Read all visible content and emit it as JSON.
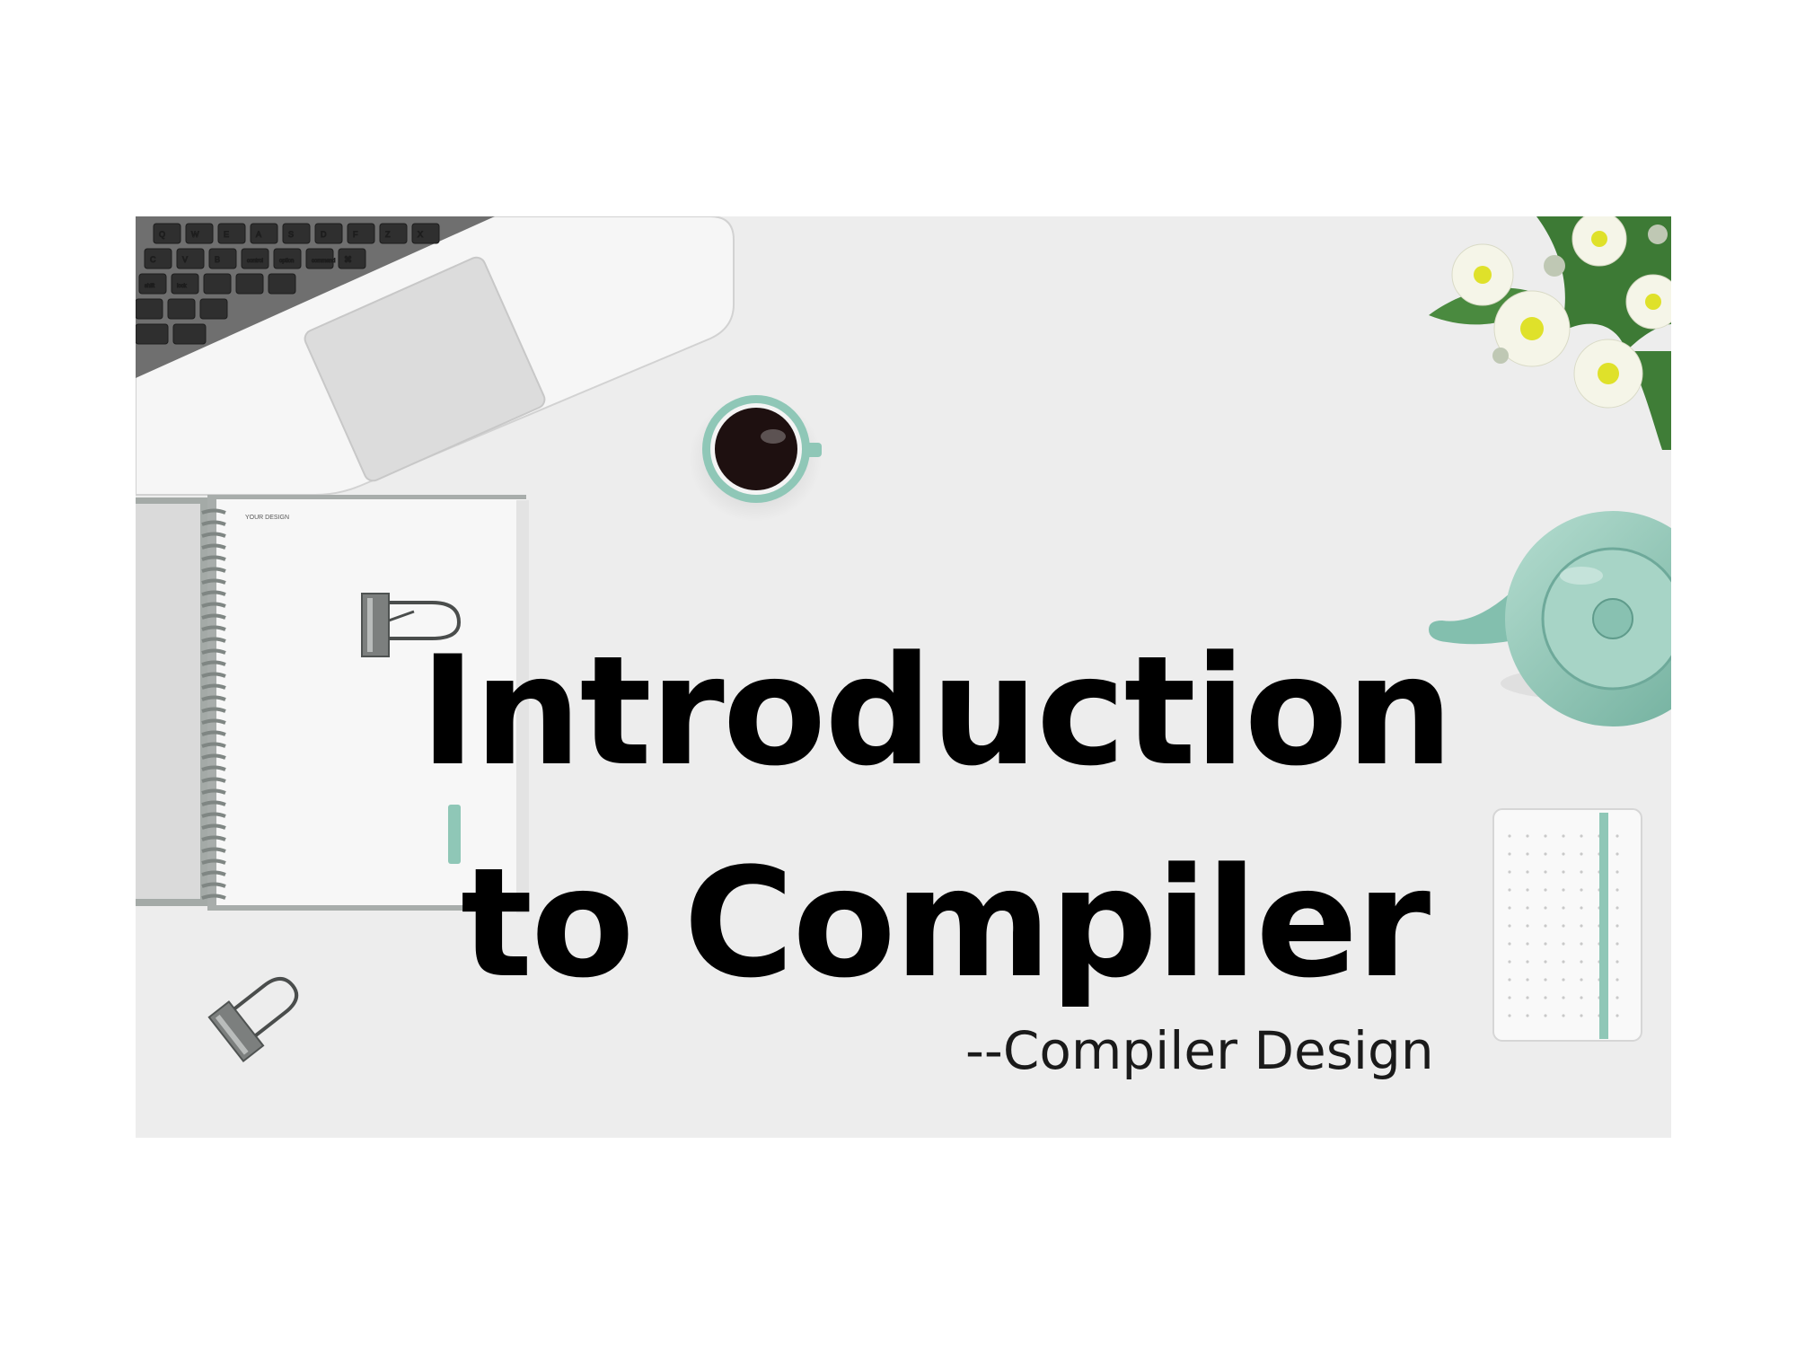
{
  "slide": {
    "title_line_1": "Introduction",
    "title_line_2": "to Compiler",
    "subtitle": "--Compiler Design",
    "notebook_label": "YOUR DESIGN"
  },
  "keyboard_keys": [
    "Q",
    "W",
    "E",
    "A",
    "S",
    "D",
    "F",
    "Z",
    "X",
    "C",
    "V",
    "B",
    "control",
    "option",
    "command",
    "⌘",
    "shift",
    "lock"
  ],
  "colors": {
    "slide_background": "#ededed",
    "page_background": "#ffffff",
    "accent_teal": "#8fc7b7",
    "title_text": "#000000"
  }
}
